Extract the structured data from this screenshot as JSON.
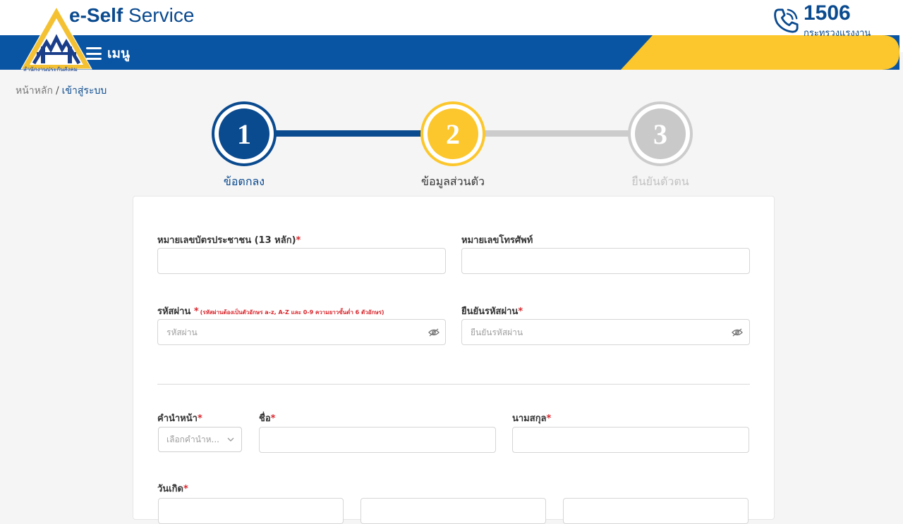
{
  "header": {
    "brand_bold": "e-Self",
    "brand_light": "Service",
    "logo_caption": "สำนักงานประกันสังคม",
    "hotline_number": "1506",
    "hotline_ministry": "กระทรวงแรงงาน",
    "menu_label": "เมนู",
    "colors": {
      "primary_blue": "#0a55a3",
      "accent_yellow": "#fcc72c"
    }
  },
  "breadcrumb": {
    "home": "หน้าหลัก",
    "separator": "/",
    "current": "เข้าสู่ระบบ"
  },
  "stepper": {
    "steps": [
      {
        "number": "1",
        "label": "ข้อตกลง",
        "status": "completed"
      },
      {
        "number": "2",
        "label": "ข้อมูลส่วนตัว",
        "status": "active"
      },
      {
        "number": "3",
        "label": "ยืนยันตัวตน",
        "status": "pending"
      }
    ]
  },
  "form": {
    "id_card": {
      "label": "หมายเลขบัตรประชาชน (13 หลัก)",
      "required": "*",
      "value": ""
    },
    "phone": {
      "label": "หมายเลขโทรศัพท์",
      "value": ""
    },
    "password": {
      "label": "รหัสผ่าน",
      "required": "*",
      "hint": "(รหัสผ่านต้องเป็นตัวอักษร a-z, A-Z และ 0-9 ความยาวขั้นต่ำ 6 ตัวอักษร)",
      "placeholder": "รหัสผ่าน"
    },
    "confirm_password": {
      "label": "ยืนยันรหัสผ่าน",
      "required": "*",
      "placeholder": "ยืนยันรหัสผ่าน"
    },
    "title": {
      "label": "คำนำหน้า",
      "required": "*",
      "placeholder": "เลือกคำนำห..."
    },
    "first_name": {
      "label": "ชื่อ",
      "required": "*",
      "value": ""
    },
    "last_name": {
      "label": "นามสกุล",
      "required": "*",
      "value": ""
    },
    "birth_date": {
      "label": "วันเกิด",
      "required": "*"
    }
  }
}
